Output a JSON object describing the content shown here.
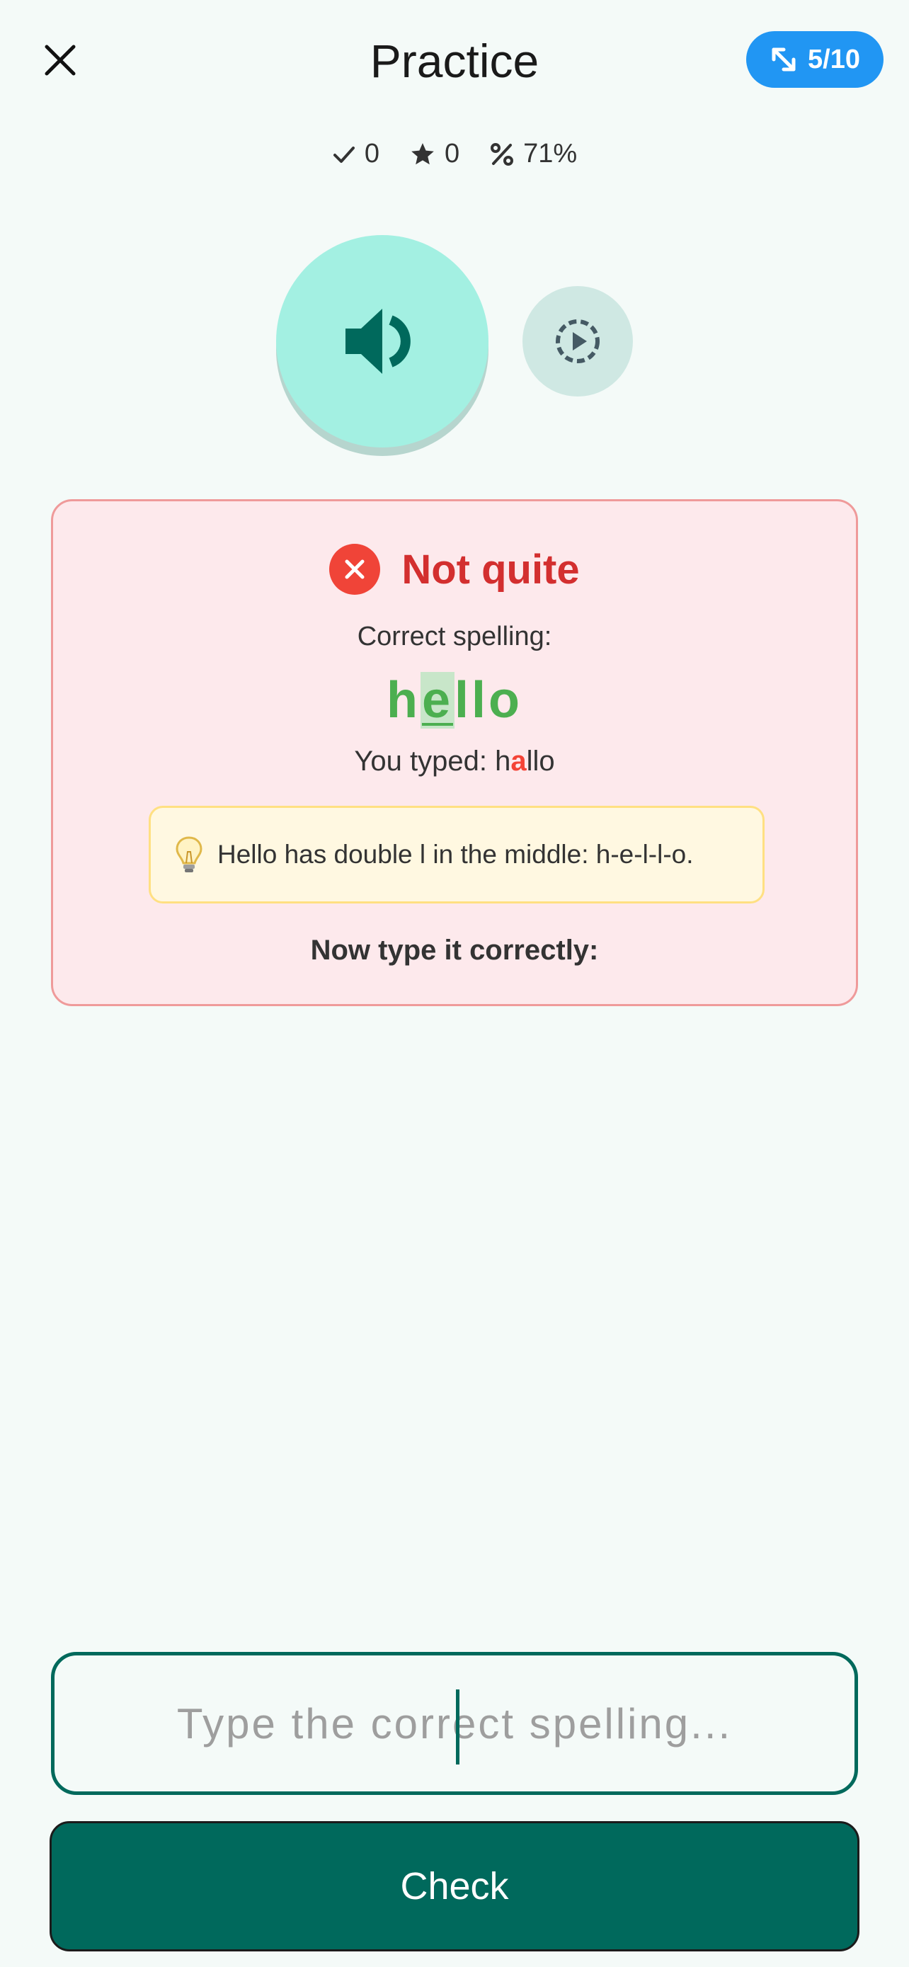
{
  "header": {
    "title": "Practice",
    "progress": "5/10"
  },
  "stats": {
    "correct": "0",
    "stars": "0",
    "accuracy": "71%"
  },
  "feedback": {
    "title": "Not quite",
    "correct_label": "Correct spelling:",
    "correct_word": {
      "before": "h",
      "highlight": "e",
      "after": "llo"
    },
    "typed_label": "You typed:",
    "typed_word": {
      "before": "h",
      "wrong": "a",
      "after": "llo"
    },
    "hint": "Hello has double l in the middle: h-e-l-l-o.",
    "prompt": "Now type it correctly:"
  },
  "input": {
    "placeholder": "Type the correct spelling..."
  },
  "check_button": "Check",
  "colors": {
    "accent": "#00695c",
    "progress_pill": "#2196f3",
    "error": "#d32f2f",
    "correct": "#4caf50"
  }
}
